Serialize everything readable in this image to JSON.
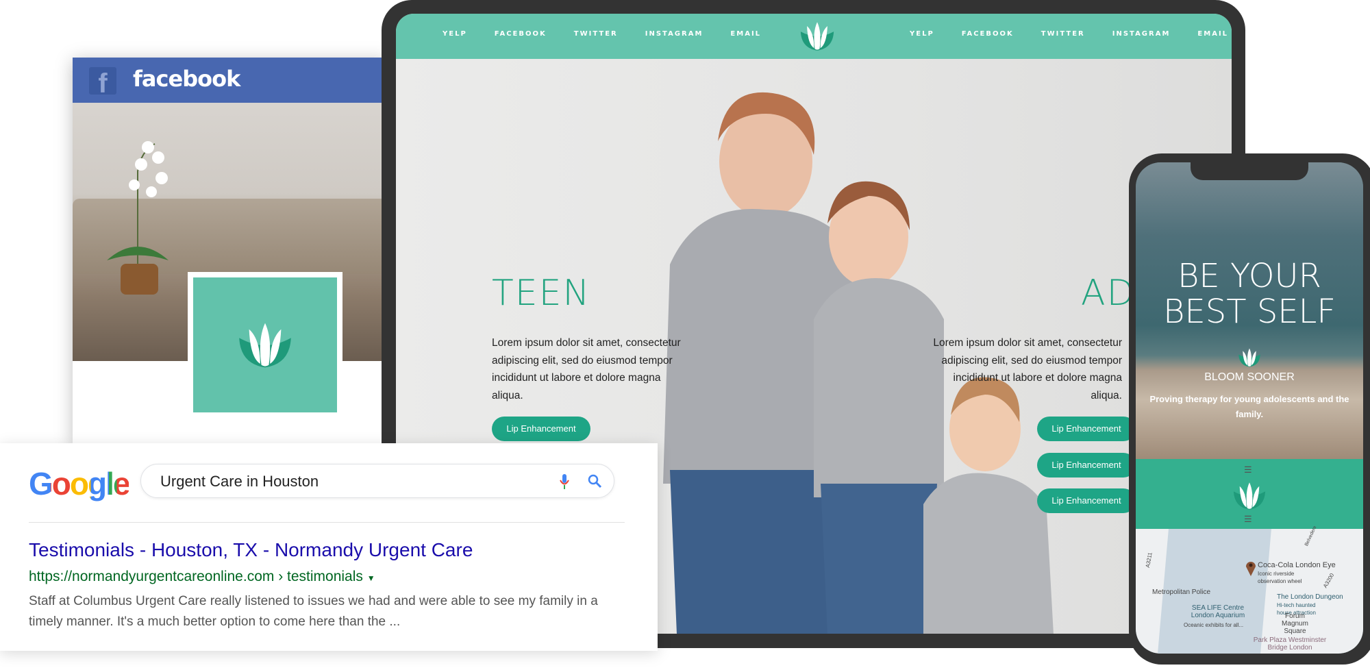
{
  "facebook": {
    "title": "facebook",
    "brand_color": "#4867b0"
  },
  "google": {
    "logo": "Google",
    "query": "Urgent Care in Houston",
    "result": {
      "title": "Testimonials - Houston, TX - Normandy Urgent Care",
      "url": "https://normandyurgentcareonline.com › testimonials",
      "snippet": "Staff at Columbus Urgent Care really listened to issues we had and were able to see my family in a timely manner. It's a much better option to come here than the ..."
    }
  },
  "tablet": {
    "nav_left": [
      "YELP",
      "FACEBOOK",
      "TWITTER",
      "INSTAGRAM",
      "EMAIL"
    ],
    "nav_right": [
      "YELP",
      "FACEBOOK",
      "TWITTER",
      "INSTAGRAM",
      "EMAIL"
    ],
    "teen": {
      "heading": "TEEN",
      "body": "Lorem ipsum dolor sit amet, consectetur adipiscing elit, sed do eiusmod tempor incididunt ut labore et dolore magna aliqua.",
      "button": "Lip Enhancement"
    },
    "adult": {
      "heading": "ADULT",
      "body": "Lorem ipsum dolor sit amet, consectetur adipiscing elit, sed do eiusmod tempor incididunt ut labore et dolore magna aliqua.",
      "buttons": [
        "Lip Enhancement",
        "Lip Enhancement",
        "Lip Enhancement"
      ]
    },
    "accent": "#64c4ad"
  },
  "phone": {
    "headline": "BE YOUR BEST SELF",
    "brand": "BLOOM SOONER",
    "tagline": "Proving therapy for young adolescents and the family.",
    "map": {
      "place": "Coca-Cola London Eye",
      "place_desc": "Iconic riverside observation wheel",
      "labels": [
        "Metropolitan Police",
        "SEA LIFE Centre London Aquarium",
        "Oceanic exhibits for all...",
        "The London Dungeon",
        "Hi-tech haunted house attraction",
        "Forum Magnum Square",
        "Park Plaza Westminster Bridge London",
        "A3211",
        "A3200",
        "Belvedere"
      ]
    }
  }
}
